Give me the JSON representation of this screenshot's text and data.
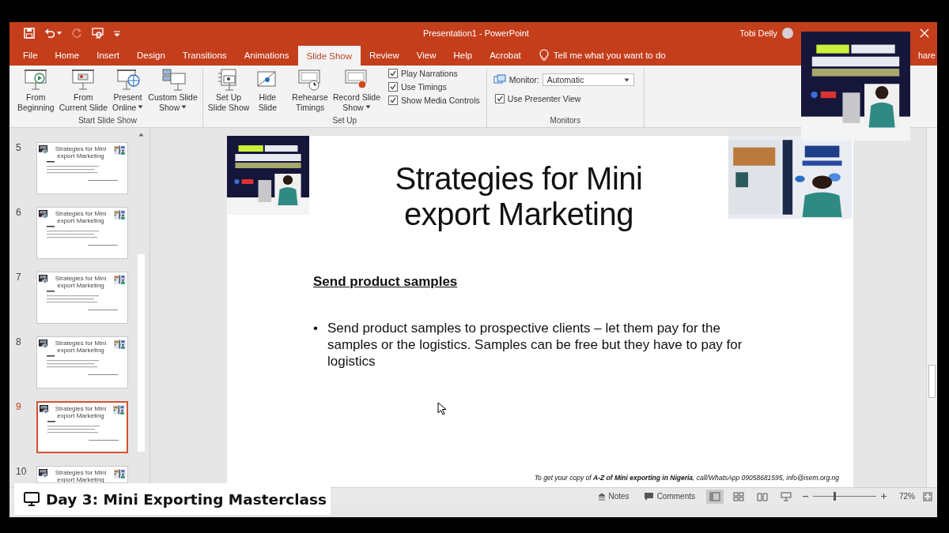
{
  "window": {
    "title": "Presentation1  -  PowerPoint",
    "user": "Tobi Delly"
  },
  "menu_tabs": [
    {
      "label": "File",
      "selected": false
    },
    {
      "label": "Home",
      "selected": false
    },
    {
      "label": "Insert",
      "selected": false
    },
    {
      "label": "Design",
      "selected": false
    },
    {
      "label": "Transitions",
      "selected": false
    },
    {
      "label": "Animations",
      "selected": false
    },
    {
      "label": "Slide Show",
      "selected": true
    },
    {
      "label": "Review",
      "selected": false
    },
    {
      "label": "View",
      "selected": false
    },
    {
      "label": "Help",
      "selected": false
    },
    {
      "label": "Acrobat",
      "selected": false
    }
  ],
  "tell_me": {
    "placeholder": "Tell me what you want to do"
  },
  "share": "hare",
  "ribbon": {
    "groups": [
      {
        "label": "Start Slide Show",
        "buttons": [
          {
            "lines": [
              "From",
              "Beginning"
            ],
            "dropdown": false
          },
          {
            "lines": [
              "From",
              "Current Slide"
            ],
            "dropdown": false
          },
          {
            "lines": [
              "Present",
              "Online"
            ],
            "dropdown": true
          },
          {
            "lines": [
              "Custom Slide",
              "Show"
            ],
            "dropdown": true
          }
        ]
      },
      {
        "label": "Set Up",
        "buttons": [
          {
            "lines": [
              "Set Up",
              "Slide Show"
            ],
            "dropdown": false
          },
          {
            "lines": [
              "Hide",
              "Slide"
            ],
            "dropdown": false
          },
          {
            "lines": [
              "Rehearse",
              "Timings"
            ],
            "dropdown": false
          },
          {
            "lines": [
              "Record Slide",
              "Show"
            ],
            "dropdown": true
          }
        ],
        "checkboxes": [
          {
            "label": "Play Narrations",
            "checked": true
          },
          {
            "label": "Use Timings",
            "checked": true
          },
          {
            "label": "Show Media Controls",
            "checked": true
          }
        ]
      },
      {
        "label": "Monitors",
        "monitor": {
          "label": "Monitor:",
          "value": "Automatic"
        },
        "checkboxes": [
          {
            "label": "Use Presenter View",
            "checked": true
          }
        ]
      }
    ]
  },
  "slides_panel": {
    "slides": [
      {
        "number": "5",
        "title": "Strategies for Mini export Marketing",
        "selected": false
      },
      {
        "number": "6",
        "title": "Strategies for Mini export Marketing",
        "selected": false
      },
      {
        "number": "7",
        "title": "Strategies for Mini export Marketing",
        "selected": false
      },
      {
        "number": "8",
        "title": "Strategies for Mini export Marketing",
        "selected": false
      },
      {
        "number": "9",
        "title": "Strategies for Mini export Marketing",
        "selected": true
      },
      {
        "number": "10",
        "title": "Strategies for Mini export Marketing",
        "selected": false
      }
    ]
  },
  "slide": {
    "title_lines": [
      "Strategies for Mini",
      "export Marketing"
    ],
    "heading": "Send product samples",
    "bullet_marker": "•",
    "bullets": [
      "Send product samples to prospective clients – let them pay for the samples or the logistics. Samples can be free but they have to pay for logistics"
    ],
    "footer": "To get your copy of **A-Z of Mini exporting in Nigeria**, call/WhatsApp 09058681595, info@isem.org.ng"
  },
  "status_bar": {
    "notes": "Notes",
    "comments": "Comments",
    "views": [
      {
        "selected": true
      },
      {
        "selected": false
      },
      {
        "selected": false
      },
      {
        "selected": false
      }
    ],
    "zoom": {
      "level": 0.33,
      "reading": "72%"
    }
  },
  "caption": {
    "text": "Day 3: Mini Exporting Masterclass"
  }
}
